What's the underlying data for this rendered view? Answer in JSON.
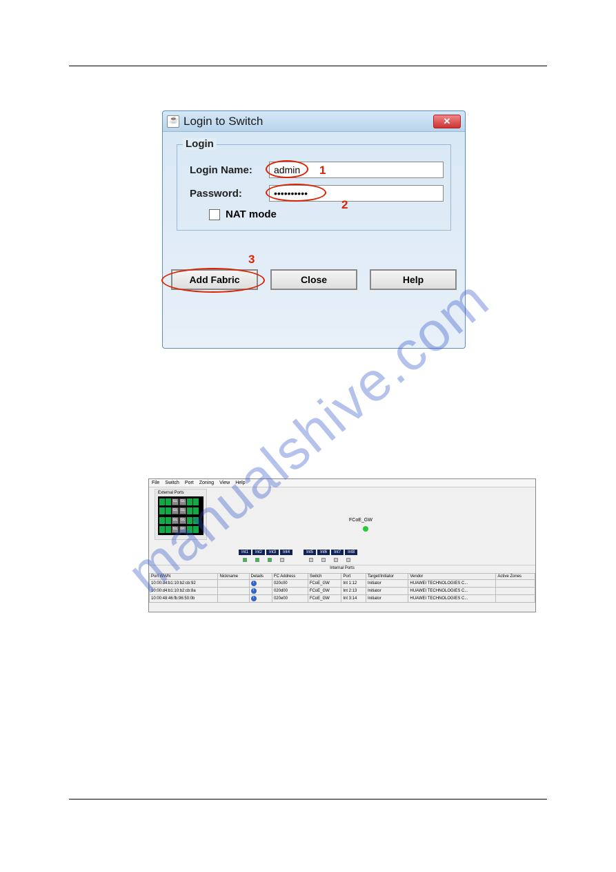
{
  "watermark": "manualshive.com",
  "login": {
    "title": "Login to Switch",
    "frame_legend": "Login",
    "login_name_label": "Login Name:",
    "login_name_value": "admin",
    "password_label": "Password:",
    "password_value": "••••••••••",
    "nat_label": "NAT mode",
    "annotations": {
      "n1": "1",
      "n2": "2",
      "n3": "3"
    },
    "buttons": {
      "add_fabric": "Add Fabric",
      "close": "Close",
      "help": "Help"
    }
  },
  "fabric": {
    "menu": [
      "File",
      "Switch",
      "Port",
      "Zoning",
      "View",
      "Help"
    ],
    "panel_label": "External Ports",
    "name_label": "FCoE_GW",
    "int_ports": [
      "Int1",
      "Int2",
      "Int3",
      "Int4",
      "Int5",
      "Int6",
      "Int7",
      "Int8"
    ],
    "int_title": "Internal Ports",
    "columns": [
      "Port WWN",
      "Nickname",
      "Details",
      "FC Address",
      "Switch",
      "Port",
      "Target/Initiator",
      "Vendor",
      "Active Zones"
    ],
    "rows": [
      {
        "wwn": "10:00:d4:b1:10:b2:cb:92",
        "nick": "",
        "addr": "020c00",
        "switch": "FCoE_GW",
        "port": "Int 1:12",
        "ti": "Initiator",
        "vendor": "HUAWEI TECHNOLOGIES C..."
      },
      {
        "wwn": "10:00:d4:b1:10:b2:cb:8a",
        "nick": "",
        "addr": "020d00",
        "switch": "FCoE_GW",
        "port": "Int 2:13",
        "ti": "Initiator",
        "vendor": "HUAWEI TECHNOLOGIES C..."
      },
      {
        "wwn": "10:00:48:46:fb:96:50:0b",
        "nick": "",
        "addr": "020e00",
        "switch": "FCoE_GW",
        "port": "Int 3:14",
        "ti": "Initiator",
        "vendor": "HUAWEI TECHNOLOGIES C..."
      }
    ]
  }
}
